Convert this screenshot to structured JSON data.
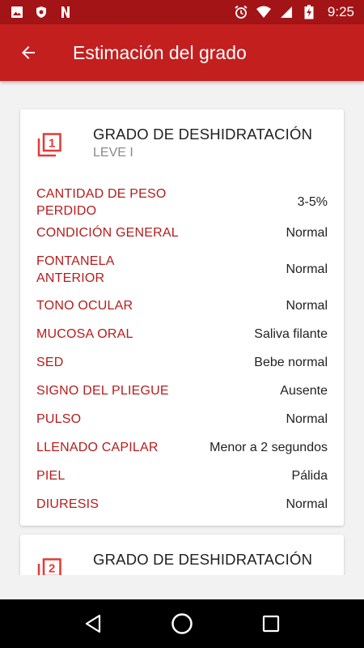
{
  "status_bar": {
    "time": "9:25",
    "left_icons": [
      "image-icon",
      "shield-icon",
      "netflix-n-icon"
    ],
    "right_icons": [
      "alarm-icon",
      "wifi-icon",
      "signal-icon",
      "battery-charging-icon"
    ]
  },
  "app_bar": {
    "title": "Estimación del grado",
    "back_icon": "arrow-back-icon"
  },
  "cards": [
    {
      "icon_number": "1",
      "title": "GRADO DE DESHIDRATACIÓN",
      "subtitle": "LEVE I",
      "rows": [
        {
          "label": "CANTIDAD DE PESO PERDIDO",
          "value": "3-5%"
        },
        {
          "label": "CONDICIÓN GENERAL",
          "value": "Normal"
        },
        {
          "label": "FONTANELA ANTERIOR",
          "value": "Normal"
        },
        {
          "label": "TONO OCULAR",
          "value": "Normal"
        },
        {
          "label": "MUCOSA ORAL",
          "value": "Saliva filante"
        },
        {
          "label": "SED",
          "value": "Bebe normal"
        },
        {
          "label": "SIGNO DEL PLIEGUE",
          "value": "Ausente"
        },
        {
          "label": "PULSO",
          "value": "Normal"
        },
        {
          "label": "LLENADO CAPILAR",
          "value": "Menor a 2 segundos"
        },
        {
          "label": "PIEL",
          "value": "Pálida"
        },
        {
          "label": "DIURESIS",
          "value": "Normal"
        }
      ]
    },
    {
      "icon_number": "2",
      "title": "GRADO DE DESHIDRATACIÓN"
    }
  ],
  "nav_bar": {
    "icons": [
      "back-triangle-icon",
      "home-circle-icon",
      "recents-square-icon"
    ]
  },
  "colors": {
    "status_bar": "#a31417",
    "app_bar": "#c41f1f",
    "label": "#b71c1c",
    "icon": "#e53935"
  }
}
